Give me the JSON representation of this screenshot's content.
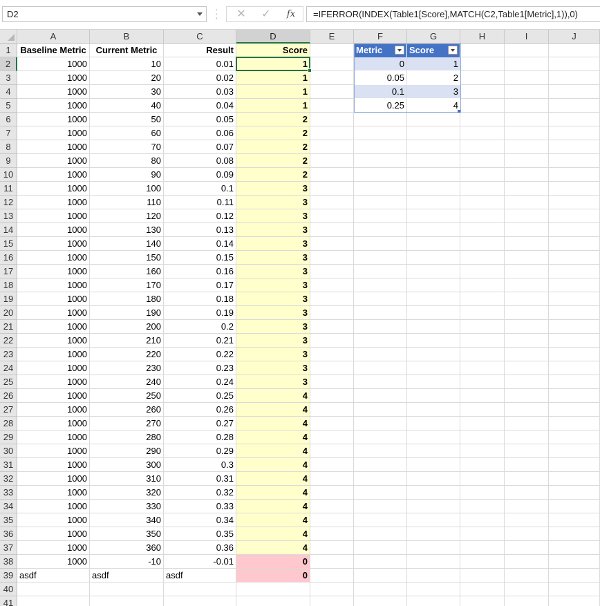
{
  "name_box": "D2",
  "formula": "=IFERROR(INDEX(Table1[Score],MATCH(C2,Table1[Metric],1)),0)",
  "icons": {
    "cancel": "✕",
    "enter": "✓",
    "fx": "fx"
  },
  "columns": [
    "A",
    "B",
    "C",
    "D",
    "E",
    "F",
    "G",
    "H",
    "I",
    "J"
  ],
  "headers": {
    "A": "Baseline Metric",
    "B": "Current Metric",
    "C": "Result",
    "D": "Score"
  },
  "rows": [
    {
      "a": "1000",
      "b": "10",
      "c": "0.01",
      "d": "1"
    },
    {
      "a": "1000",
      "b": "20",
      "c": "0.02",
      "d": "1"
    },
    {
      "a": "1000",
      "b": "30",
      "c": "0.03",
      "d": "1"
    },
    {
      "a": "1000",
      "b": "40",
      "c": "0.04",
      "d": "1"
    },
    {
      "a": "1000",
      "b": "50",
      "c": "0.05",
      "d": "2"
    },
    {
      "a": "1000",
      "b": "60",
      "c": "0.06",
      "d": "2"
    },
    {
      "a": "1000",
      "b": "70",
      "c": "0.07",
      "d": "2"
    },
    {
      "a": "1000",
      "b": "80",
      "c": "0.08",
      "d": "2"
    },
    {
      "a": "1000",
      "b": "90",
      "c": "0.09",
      "d": "2"
    },
    {
      "a": "1000",
      "b": "100",
      "c": "0.1",
      "d": "3"
    },
    {
      "a": "1000",
      "b": "110",
      "c": "0.11",
      "d": "3"
    },
    {
      "a": "1000",
      "b": "120",
      "c": "0.12",
      "d": "3"
    },
    {
      "a": "1000",
      "b": "130",
      "c": "0.13",
      "d": "3"
    },
    {
      "a": "1000",
      "b": "140",
      "c": "0.14",
      "d": "3"
    },
    {
      "a": "1000",
      "b": "150",
      "c": "0.15",
      "d": "3"
    },
    {
      "a": "1000",
      "b": "160",
      "c": "0.16",
      "d": "3"
    },
    {
      "a": "1000",
      "b": "170",
      "c": "0.17",
      "d": "3"
    },
    {
      "a": "1000",
      "b": "180",
      "c": "0.18",
      "d": "3"
    },
    {
      "a": "1000",
      "b": "190",
      "c": "0.19",
      "d": "3"
    },
    {
      "a": "1000",
      "b": "200",
      "c": "0.2",
      "d": "3"
    },
    {
      "a": "1000",
      "b": "210",
      "c": "0.21",
      "d": "3"
    },
    {
      "a": "1000",
      "b": "220",
      "c": "0.22",
      "d": "3"
    },
    {
      "a": "1000",
      "b": "230",
      "c": "0.23",
      "d": "3"
    },
    {
      "a": "1000",
      "b": "240",
      "c": "0.24",
      "d": "3"
    },
    {
      "a": "1000",
      "b": "250",
      "c": "0.25",
      "d": "4"
    },
    {
      "a": "1000",
      "b": "260",
      "c": "0.26",
      "d": "4"
    },
    {
      "a": "1000",
      "b": "270",
      "c": "0.27",
      "d": "4"
    },
    {
      "a": "1000",
      "b": "280",
      "c": "0.28",
      "d": "4"
    },
    {
      "a": "1000",
      "b": "290",
      "c": "0.29",
      "d": "4"
    },
    {
      "a": "1000",
      "b": "300",
      "c": "0.3",
      "d": "4"
    },
    {
      "a": "1000",
      "b": "310",
      "c": "0.31",
      "d": "4"
    },
    {
      "a": "1000",
      "b": "320",
      "c": "0.32",
      "d": "4"
    },
    {
      "a": "1000",
      "b": "330",
      "c": "0.33",
      "d": "4"
    },
    {
      "a": "1000",
      "b": "340",
      "c": "0.34",
      "d": "4"
    },
    {
      "a": "1000",
      "b": "350",
      "c": "0.35",
      "d": "4"
    },
    {
      "a": "1000",
      "b": "360",
      "c": "0.36",
      "d": "4"
    },
    {
      "a": "1000",
      "b": "-10",
      "c": "-0.01",
      "d": "0"
    },
    {
      "a": "asdf",
      "b": "asdf",
      "c": "asdf",
      "d": "0"
    }
  ],
  "lookup_table": {
    "headers": [
      "Metric",
      "Score"
    ],
    "rows": [
      {
        "metric": "0",
        "score": "1"
      },
      {
        "metric": "0.05",
        "score": "2"
      },
      {
        "metric": "0.1",
        "score": "3"
      },
      {
        "metric": "0.25",
        "score": "4"
      }
    ]
  },
  "colors": {
    "score_fill": "#ffffcc",
    "zero_fill": "#ffc7ce",
    "table_header": "#4472c4",
    "table_band": "#d9e1f2",
    "selection": "#217346"
  }
}
